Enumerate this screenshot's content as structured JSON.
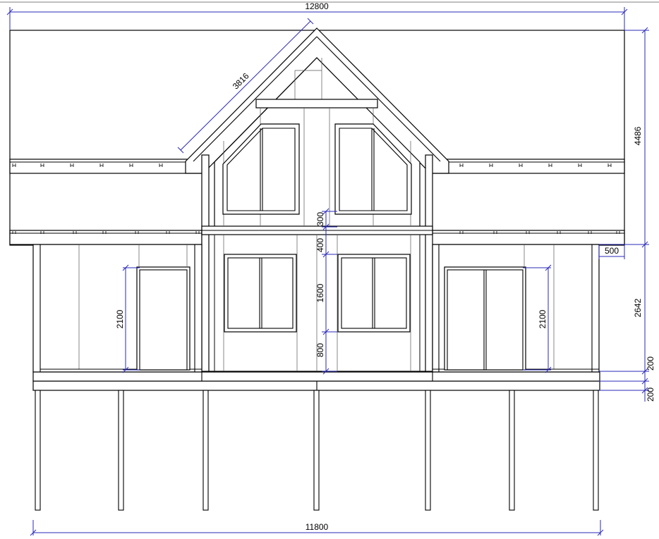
{
  "drawing": {
    "dimensions": {
      "roof_width": "12800",
      "rafter_length": "3816",
      "roof_height": "4486",
      "overhang": "500",
      "wall_height": "2642",
      "floor_offset": "200",
      "platform_offset": "200",
      "base_width": "11800",
      "left_door_height": "2100",
      "right_door_height": "2100",
      "gap_between_windows": "300",
      "beam_height": "400",
      "window_height": "1600",
      "sill_height": "800"
    }
  }
}
